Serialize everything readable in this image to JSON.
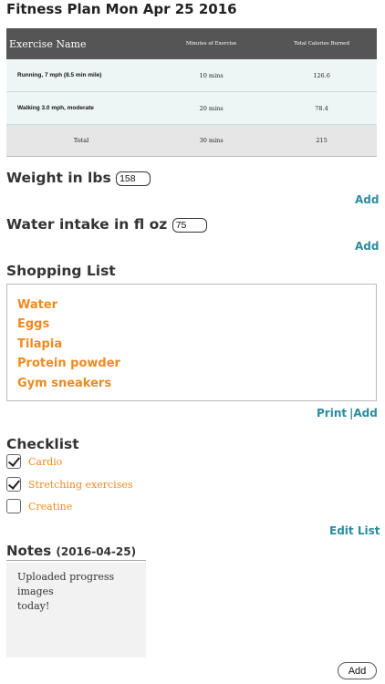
{
  "title": "Fitness Plan Mon Apr 25 2016",
  "exercise_table": {
    "headers": [
      "Exercise Name",
      "Minutes of Exercise",
      "Total Calories Burned"
    ],
    "rows": [
      {
        "name": "Running, 7 mph (8.5 min mile)",
        "minutes": "10 mins",
        "calories": "126.6"
      },
      {
        "name": "Walking 3.0 mph, moderate",
        "minutes": "20 mins",
        "calories": "78.4"
      }
    ],
    "total": {
      "label": "Total",
      "minutes": "30 mins",
      "calories": "215"
    }
  },
  "weight": {
    "label": "Weight in lbs",
    "value": "158",
    "add_label": "Add"
  },
  "water": {
    "label": "Water intake in fl oz",
    "value": "75",
    "add_label": "Add"
  },
  "shopping": {
    "title": "Shopping List",
    "items": [
      "Water",
      "Eggs",
      "Tilapia",
      "Protein powder",
      "Gym sneakers"
    ],
    "print_label": "Print",
    "add_label": "|Add"
  },
  "checklist": {
    "title": "Checklist",
    "items": [
      {
        "label": "Cardio",
        "checked": true
      },
      {
        "label": "Stretching exercises",
        "checked": true
      },
      {
        "label": "Creatine",
        "checked": false
      }
    ],
    "edit_label": "Edit List"
  },
  "notes": {
    "title": "Notes",
    "date": "(2016-04-25)",
    "lines": [
      "Uploaded progress images",
      "today!"
    ],
    "add_button": "Add"
  },
  "colors": {
    "accent_link": "#2a8ca0",
    "orange": "#ef8a1e",
    "table_header": "#555555"
  }
}
